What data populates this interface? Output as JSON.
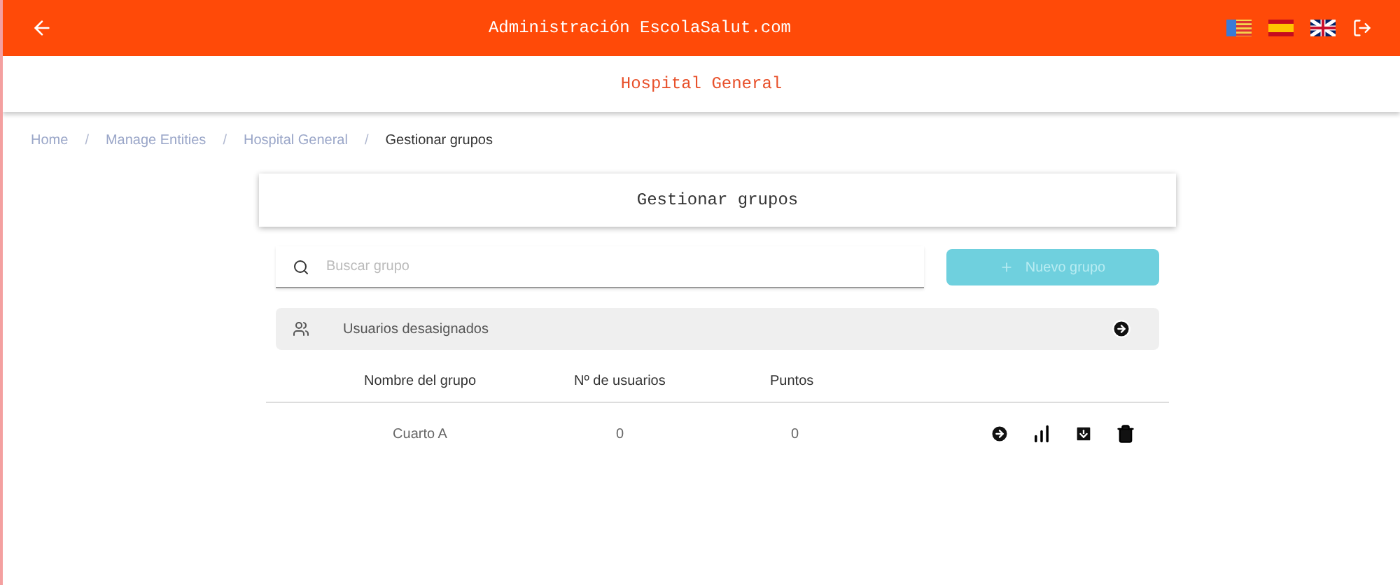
{
  "header": {
    "title": "Administración EscolaSalut.com",
    "subtitle": "Hospital General"
  },
  "breadcrumbs": [
    {
      "label": "Home",
      "current": false
    },
    {
      "separator": "/"
    },
    {
      "label": "Manage Entities",
      "current": false
    },
    {
      "separator": "/"
    },
    {
      "label": "Hospital General",
      "current": false
    },
    {
      "separator": "/"
    },
    {
      "label": "Gestionar grupos",
      "current": true
    }
  ],
  "page_title": "Gestionar grupos",
  "search": {
    "placeholder": "Buscar grupo"
  },
  "add_button": {
    "label": "Nuevo grupo",
    "disabled": true
  },
  "unassigned": {
    "label": "Usuarios desasignados"
  },
  "table": {
    "columns": [
      "Nombre del grupo",
      "Nº de usuarios",
      "Puntos"
    ],
    "rows": [
      {
        "name": "Cuarto A",
        "users": "0",
        "points": "0"
      }
    ]
  }
}
